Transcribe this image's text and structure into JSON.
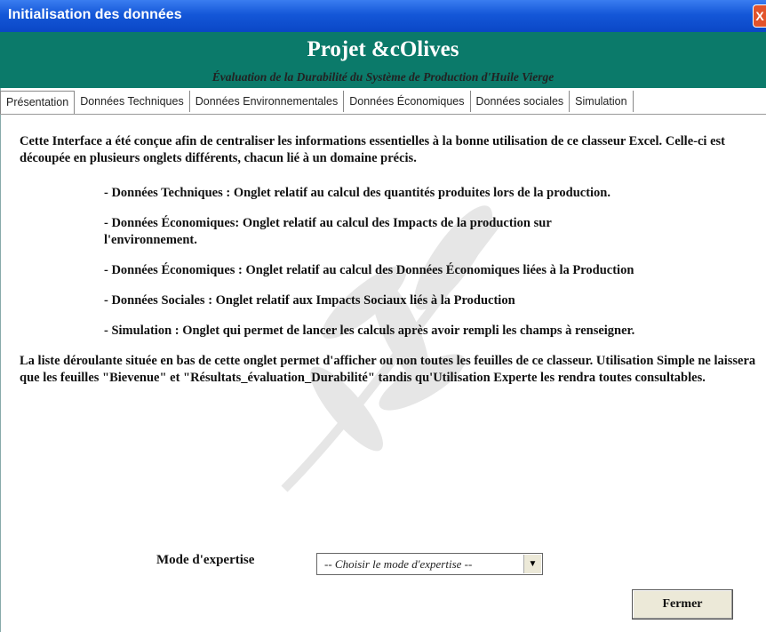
{
  "window": {
    "title": "Initialisation des données"
  },
  "banner": {
    "heading": "Projet &cOlives",
    "subtitle": "Évaluation de la Durabilité du Système de Production d'Huile Vierge"
  },
  "tabs": [
    "Présentation",
    "Données Techniques",
    "Données Environnementales",
    "Données Économiques",
    "Données sociales",
    "Simulation"
  ],
  "content": {
    "intro": "Cette Interface a été conçue afin de centraliser les informations essentielles à la bonne utilisation de ce classeur Excel. Celle-ci est découpée en plusieurs onglets différents, chacun lié à un domaine précis.",
    "items": [
      "- Données Techniques : Onglet relatif au calcul des quantités produites lors de la production.",
      "- Données Économiques: Onglet relatif au calcul des Impacts de la production sur l'environnement.",
      "- Données Économiques : Onglet relatif au calcul des Données Économiques liées à la Production",
      "- Données Sociales : Onglet relatif aux Impacts Sociaux liés à la Production",
      "- Simulation : Onglet qui permet de lancer les calculs après avoir rempli les champs à renseigner."
    ],
    "outro": "La liste déroulante située en bas de cette onglet permet d'afficher ou non toutes les feuilles de ce classeur. Utilisation Simple ne laissera que les feuilles \"Bievenue\" et \"Résultats_évaluation_Durabilité\" tandis qu'Utilisation Experte les rendra toutes consultables."
  },
  "mode": {
    "label": "Mode d'expertise",
    "selected": "-- Choisir le mode d'expertise --"
  },
  "buttons": {
    "close": "Fermer"
  },
  "icons": {
    "close": "close-icon",
    "dropdown": "chevron-down-icon",
    "watermark": "olive-branch-icon"
  },
  "colors": {
    "titlebar": "#1457d8",
    "banner": "#0b7a6a",
    "close": "#e2532b"
  }
}
